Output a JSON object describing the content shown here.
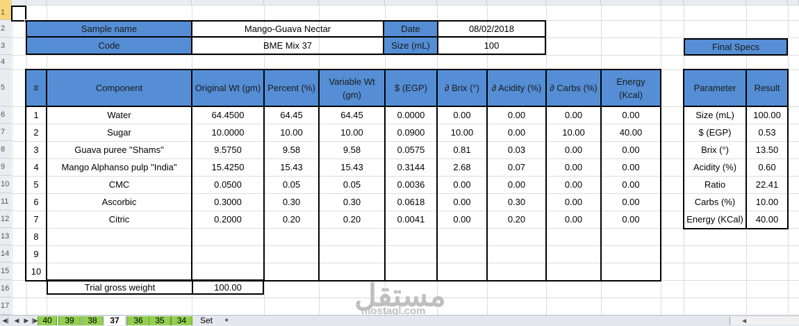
{
  "columns": [
    "A",
    "B",
    "C",
    "D",
    "E",
    "F",
    "G",
    "H",
    "J",
    "K",
    "N",
    "S",
    "T",
    "U",
    "V"
  ],
  "rows": [
    "1",
    "2",
    "3",
    "4",
    "5",
    "6",
    "7",
    "8",
    "9",
    "10",
    "11",
    "12",
    "13",
    "14",
    "15",
    "16",
    "17"
  ],
  "info": {
    "sample_label": "Sample name",
    "sample_value": "Mango-Guava Nectar",
    "date_label": "Date",
    "date_value": "08/02/2018",
    "code_label": "Code",
    "code_value": "BME Mix 37",
    "size_label": "Size (mL)",
    "size_value": "100"
  },
  "final_specs": "Final Specs",
  "main_headers": [
    "#",
    "Component",
    "Original Wt (gm)",
    "Percent (%)",
    "Variable Wt (gm)",
    "$ (EGP)",
    "∂ Brix (°)",
    "∂ Acidity (%)",
    "∂  Carbs (%)",
    "Energy (Kcal)"
  ],
  "main_rows": [
    [
      "1",
      "Water",
      "64.4500",
      "64.45",
      "64.45",
      "0.0000",
      "0.00",
      "0.00",
      "0.00",
      "0.00"
    ],
    [
      "2",
      "Sugar",
      "10.0000",
      "10.00",
      "10.00",
      "0.0900",
      "10.00",
      "0.00",
      "10.00",
      "40.00"
    ],
    [
      "3",
      "Guava puree \"Shams\"",
      "9.5750",
      "9.58",
      "9.58",
      "0.0575",
      "0.81",
      "0.03",
      "0.00",
      "0.00"
    ],
    [
      "4",
      "Mango Alphanso pulp \"India\"",
      "15.4250",
      "15.43",
      "15.43",
      "0.3144",
      "2.68",
      "0.07",
      "0.00",
      "0.00"
    ],
    [
      "5",
      "CMC",
      "0.0500",
      "0.05",
      "0.05",
      "0.0036",
      "0.00",
      "0.00",
      "0.00",
      "0.00"
    ],
    [
      "6",
      "Ascorbic",
      "0.3000",
      "0.30",
      "0.30",
      "0.0618",
      "0.00",
      "0.30",
      "0.00",
      "0.00"
    ],
    [
      "7",
      "Citric",
      "0.2000",
      "0.20",
      "0.20",
      "0.0041",
      "0.00",
      "0.20",
      "0.00",
      "0.00"
    ],
    [
      "8",
      "",
      "",
      "",
      "",
      "",
      "",
      "",
      "",
      ""
    ],
    [
      "9",
      "",
      "",
      "",
      "",
      "",
      "",
      "",
      "",
      ""
    ],
    [
      "10",
      "",
      "",
      "",
      "",
      "",
      "",
      "",
      "",
      ""
    ]
  ],
  "trial": {
    "label": "Trial gross weight",
    "value": "100.00"
  },
  "spec_headers": [
    "Parameter",
    "Result"
  ],
  "spec_rows": [
    [
      "Size (mL)",
      "100.00"
    ],
    [
      "$ (EGP)",
      "0.53"
    ],
    [
      "Brix (°)",
      "13.50"
    ],
    [
      "Acidity (%)",
      "0.60"
    ],
    [
      "Ratio",
      "22.41"
    ],
    [
      "Carbs (%)",
      "10.00"
    ],
    [
      "Energy (KCal)",
      "40.00"
    ]
  ],
  "tabs": [
    "40",
    "39",
    "38",
    "37",
    "36",
    "35",
    "34",
    "Set"
  ],
  "active_tab": "37",
  "watermark": {
    "arabic": "مستقل",
    "latin": "mostaql.com"
  },
  "colors": {
    "header_blue": "#558ed5",
    "tab_green": "#92d050",
    "selection": "#f7d77a"
  }
}
